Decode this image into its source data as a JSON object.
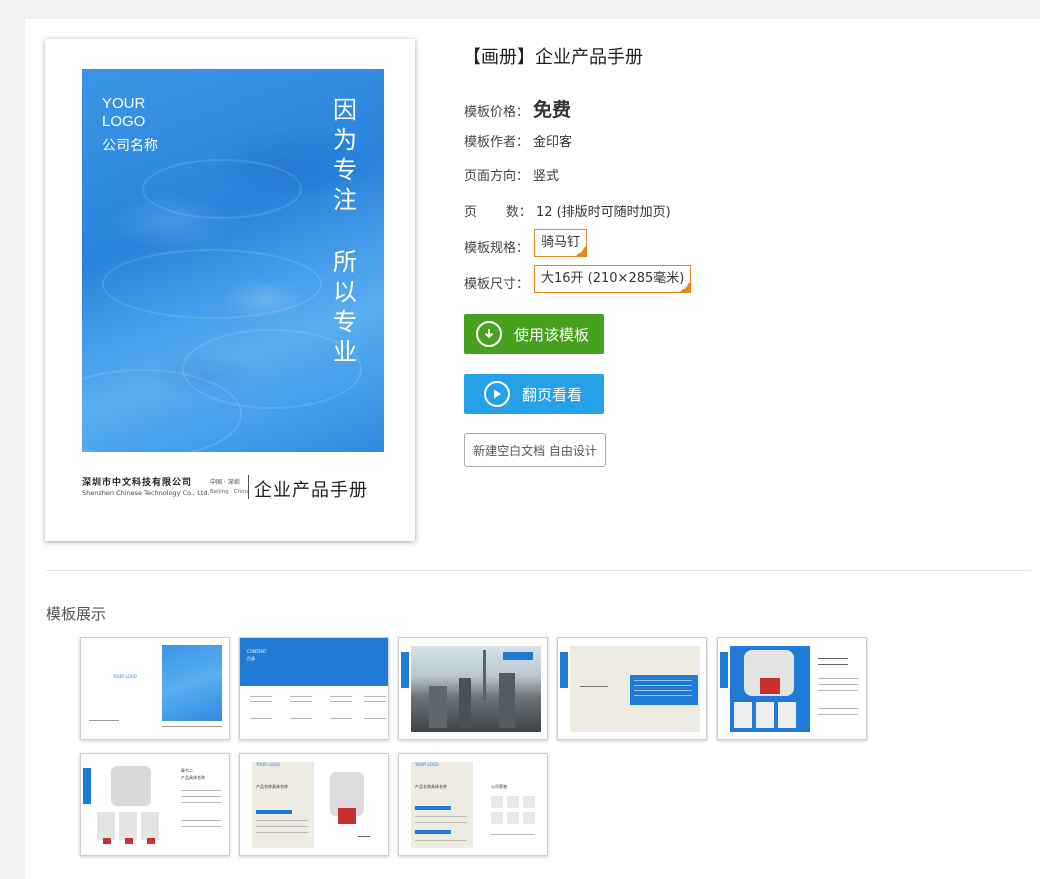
{
  "product": {
    "title": "【画册】企业产品手册",
    "price_label": "模板价格：",
    "price_value": "免费",
    "author_label": "模板作者：",
    "author_value": "金印客",
    "orientation_label": "页面方向：",
    "orientation_value": "竖式",
    "pages_label": "页       数：",
    "pages_value": "12 (排版时可随时加页)",
    "spec_label": "模板规格：",
    "spec_value": "骑马钉",
    "size_label": "模板尺寸：",
    "size_value": "大16开 (210×285毫米)"
  },
  "cover": {
    "logo_line1": "YOUR",
    "logo_line2": "LOGO",
    "company": "公司名称",
    "slogan1": "因为专注",
    "slogan2": "所以专业",
    "foot_cn": "深圳市中文科技有限公司",
    "foot_en": "Shenzhen Chinese Technology Co., Ltd.",
    "foot_loc_cn": "中国 · 深圳",
    "foot_loc_en": "Beijing · China",
    "foot_title": "企业产品手册"
  },
  "buttons": {
    "use": "使用该模板",
    "flip": "翻页看看",
    "blank": "新建空白文档 自由设计"
  },
  "gallery": {
    "title": "模板展示",
    "t1_logo": "YOUR LOGO",
    "t2_content": "CONTENT",
    "t2_sub": "目录",
    "t7_section": "章节二",
    "t7_name": "产品具体名称",
    "t8_title": "产品名称具体名称",
    "t9_title": "产品名称具体名称",
    "t9_sub": "公司荣誉"
  },
  "colors": {
    "brand_blue": "#1f7bd6",
    "use_green": "#47a11f",
    "flip_blue": "#26a0e6",
    "price_red": "#e03c3c",
    "tag_orange": "#e28a1b"
  }
}
